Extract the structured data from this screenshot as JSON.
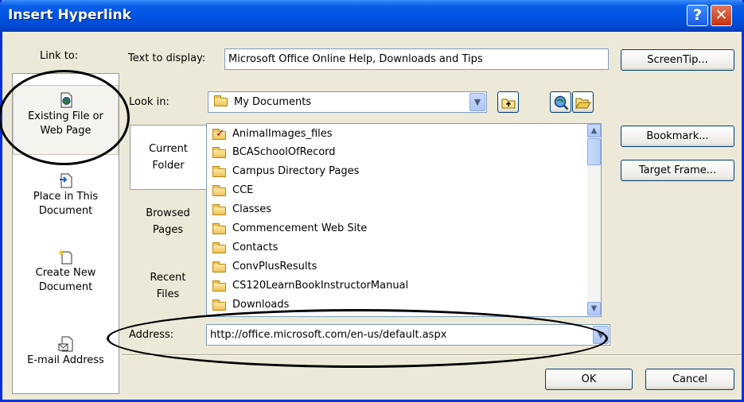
{
  "dialog": {
    "title": "Insert Hyperlink",
    "help_glyph": "?",
    "close_glyph": "✕"
  },
  "link_to": {
    "label": "Link to:",
    "items": [
      {
        "line1": "Existing File or",
        "line2": "Web Page",
        "icon": "web-page-icon",
        "selected": true
      },
      {
        "line1": "Place in This",
        "line2": "Document",
        "icon": "document-place-icon",
        "selected": false
      },
      {
        "line1": "Create New",
        "line2": "Document",
        "icon": "new-document-icon",
        "selected": false
      },
      {
        "line1": "E-mail Address",
        "line2": "",
        "icon": "email-icon",
        "selected": false
      }
    ]
  },
  "text_to_display": {
    "label": "Text to display:",
    "value": "Microsoft Office Online Help, Downloads and Tips"
  },
  "buttons": {
    "screentip": "ScreenTip...",
    "bookmark": "Bookmark...",
    "target_frame": "Target Frame...",
    "ok": "OK",
    "cancel": "Cancel"
  },
  "look_in": {
    "label": "Look in:",
    "value": "My Documents"
  },
  "tabs": [
    {
      "line1": "Current",
      "line2": "Folder",
      "selected": true
    },
    {
      "line1": "Browsed",
      "line2": "Pages",
      "selected": false
    },
    {
      "line1": "Recent",
      "line2": "Files",
      "selected": false
    }
  ],
  "files": [
    {
      "name": "AnimalImages_files",
      "icon": "checked-folder-icon"
    },
    {
      "name": "BCASchoolOfRecord",
      "icon": "folder-icon"
    },
    {
      "name": "Campus Directory Pages",
      "icon": "folder-icon"
    },
    {
      "name": "CCE",
      "icon": "folder-icon"
    },
    {
      "name": "Classes",
      "icon": "folder-icon"
    },
    {
      "name": "Commencement Web Site",
      "icon": "folder-icon"
    },
    {
      "name": "Contacts",
      "icon": "folder-icon"
    },
    {
      "name": "ConvPlusResults",
      "icon": "folder-icon"
    },
    {
      "name": "CS120LearnBookInstructorManual",
      "icon": "folder-icon"
    },
    {
      "name": "Downloads",
      "icon": "folder-icon"
    }
  ],
  "address": {
    "label": "Address:",
    "value": "http://office.microsoft.com/en-us/default.aspx"
  },
  "colors": {
    "title_bar": "#0054E3",
    "dialog_bg": "#ECE9D8",
    "annotation": "#000000"
  }
}
